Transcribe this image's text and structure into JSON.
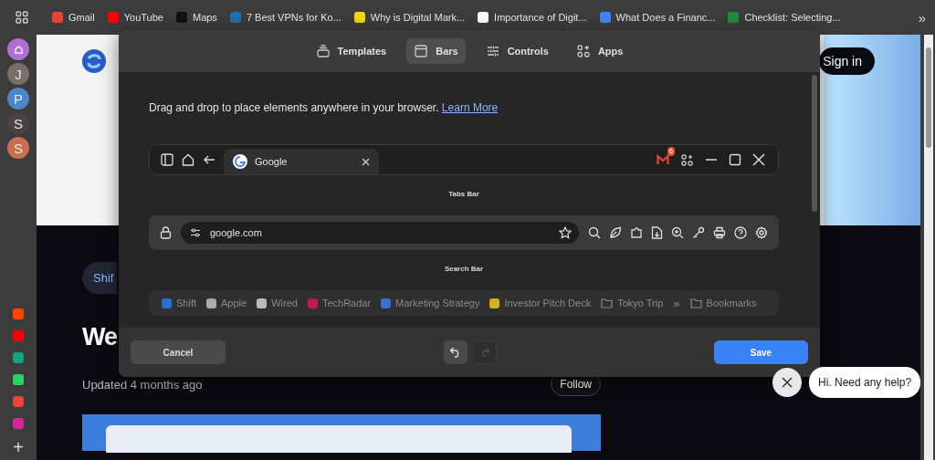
{
  "bookmarks_bar": {
    "items": [
      {
        "label": "Gmail",
        "color": "#ea4335"
      },
      {
        "label": "YouTube",
        "color": "#ff0000"
      },
      {
        "label": "Maps",
        "color": "#111111"
      },
      {
        "label": "7 Best VPNs for Ko...",
        "color": "#1f6fb5"
      },
      {
        "label": "Why is Digital Mark...",
        "color": "#f5d800"
      },
      {
        "label": "Importance of Digit...",
        "color": "#ffffff"
      },
      {
        "label": "What Does a Financ...",
        "color": "#4285f4"
      },
      {
        "label": "Checklist: Selecting...",
        "color": "#1e8e3e"
      }
    ],
    "overflow": "»"
  },
  "sidebar": {
    "spaces": [
      {
        "kind": "home",
        "color": "#b06fd6"
      },
      {
        "kind": "letter",
        "label": "J",
        "color": "#7a6e68"
      },
      {
        "kind": "letter",
        "label": "P",
        "color": "#4a86c8"
      },
      {
        "kind": "letter",
        "label": "S",
        "color": "#4a4240"
      },
      {
        "kind": "letter",
        "label": "S",
        "color": "#c8704e"
      }
    ],
    "apps": [
      {
        "color": "#ff4500"
      },
      {
        "color": "#ff0000"
      },
      {
        "color": "#10a37f"
      },
      {
        "color": "#25d366"
      },
      {
        "color": "#ea4335"
      },
      {
        "color": "#d6249f"
      }
    ],
    "add": "+"
  },
  "page": {
    "sign_in": "Sign in",
    "pill": "Shif",
    "heading": "We",
    "updated": "Updated 4 months ago",
    "follow": "Follow"
  },
  "modal": {
    "tabs": [
      {
        "kind": "templates",
        "label": "Templates",
        "selected": false
      },
      {
        "kind": "bars",
        "label": "Bars",
        "selected": true
      },
      {
        "kind": "controls",
        "label": "Controls",
        "selected": false
      },
      {
        "kind": "apps",
        "label": "Apps",
        "selected": false
      }
    ],
    "instruction": "Drag and drop to place elements anywhere in your browser.",
    "learn_more": "Learn More",
    "tabs_bar": {
      "tab_title": "Google",
      "mail_badge": "6",
      "caption": "Tabs Bar"
    },
    "search_bar": {
      "url": "google.com",
      "caption": "Search Bar"
    },
    "bookmarks": {
      "items": [
        {
          "kind": "site",
          "label": "Shift",
          "color": "#2a6fd6"
        },
        {
          "kind": "site",
          "label": "Apple",
          "color": "#aaaaaa"
        },
        {
          "kind": "site",
          "label": "Wired",
          "color": "#bbbbbb"
        },
        {
          "kind": "site",
          "label": "TechRadar",
          "color": "#c2185b"
        },
        {
          "kind": "site",
          "label": "Marketing Strategy",
          "color": "#3b6fd6"
        },
        {
          "kind": "site",
          "label": "Investor Pitch Deck",
          "color": "#d4b21e"
        },
        {
          "kind": "folder",
          "label": "Tokyo Trip"
        },
        {
          "kind": "more",
          "label": "»"
        },
        {
          "kind": "folder",
          "label": "Bookmarks"
        }
      ]
    },
    "history": [
      {
        "kind": "undo",
        "disabled": false
      },
      {
        "kind": "redo",
        "disabled": true
      }
    ],
    "cancel": "Cancel",
    "save": "Save"
  },
  "chat": {
    "message": "Hi. Need any help?"
  }
}
